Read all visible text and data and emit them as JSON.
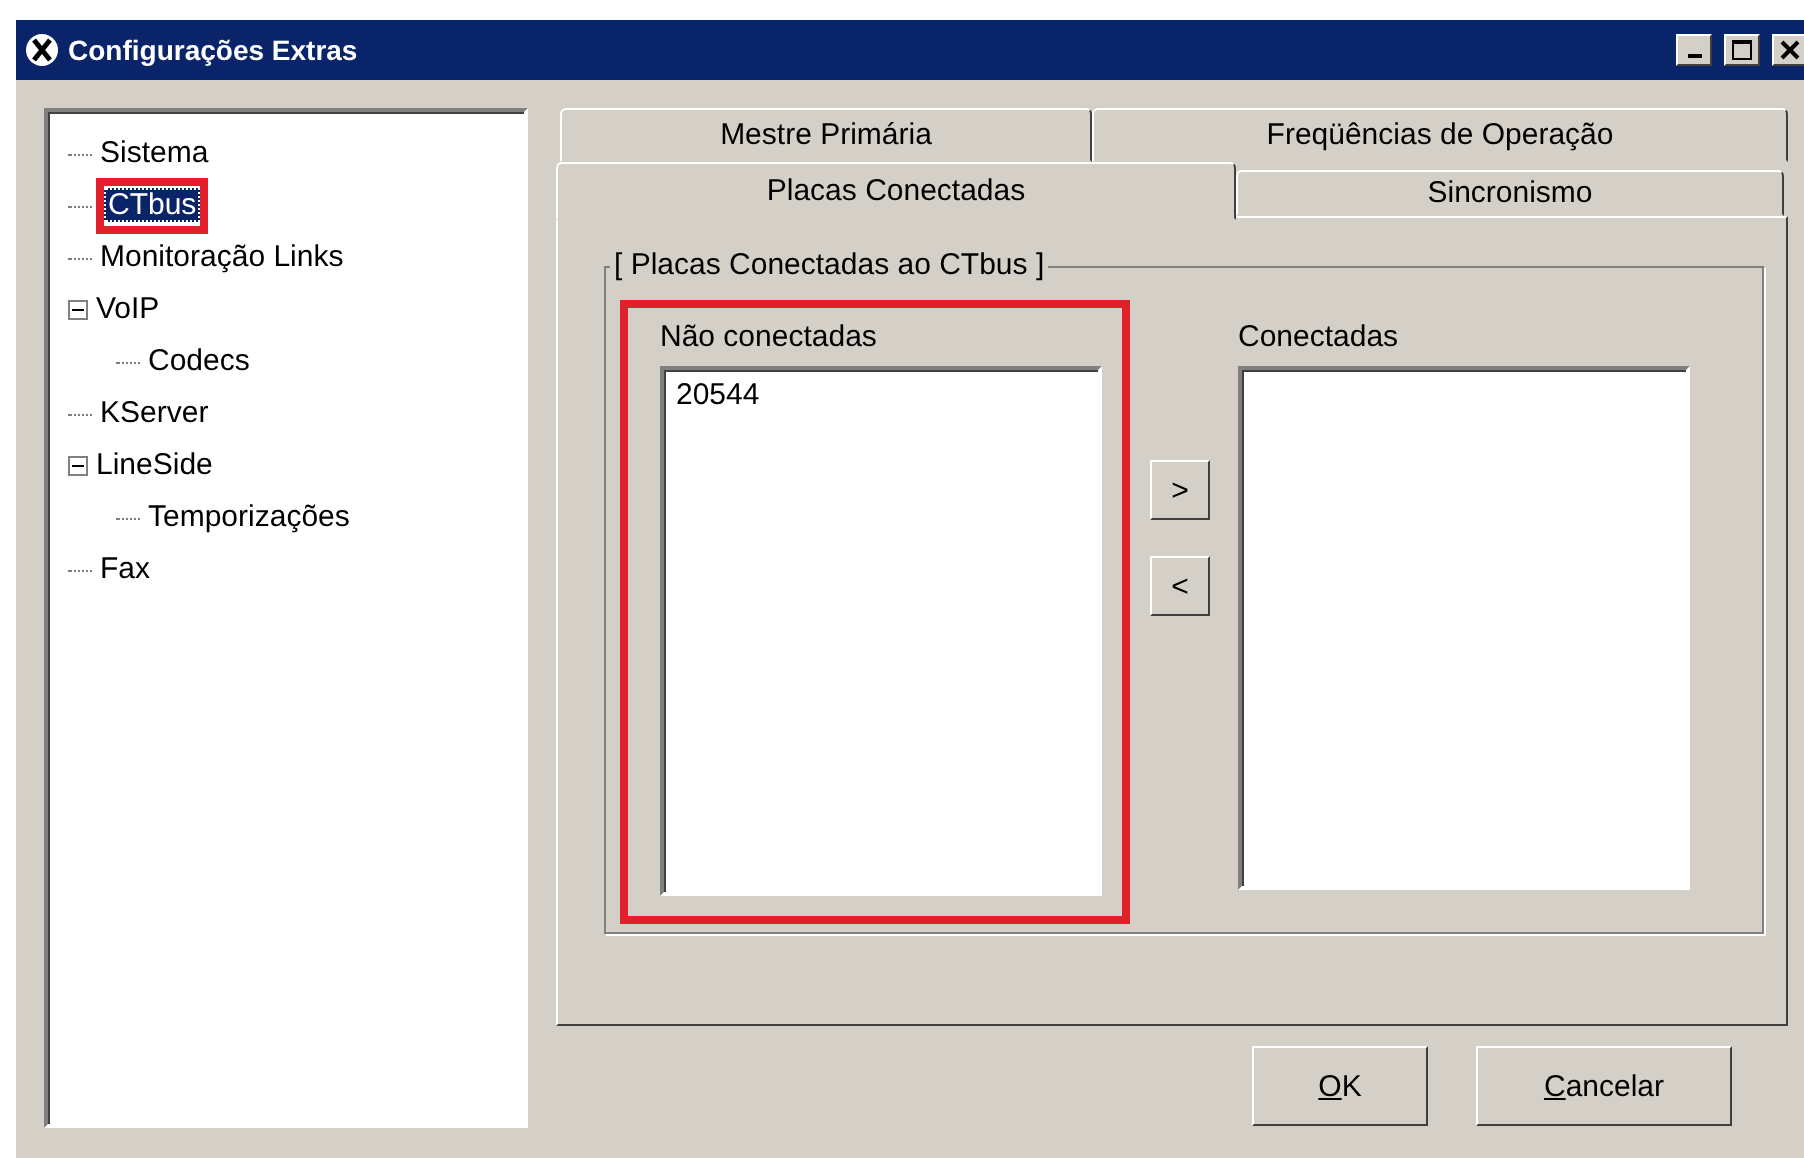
{
  "window": {
    "title": "Configurações Extras"
  },
  "tree": [
    {
      "label": "Sistema",
      "selected": false
    },
    {
      "label": "CTbus",
      "selected": true,
      "highlighted": true
    },
    {
      "label": "Monitoração Links",
      "selected": false
    },
    {
      "label": "VoIP",
      "selected": false,
      "expanded": true,
      "children": [
        {
          "label": "Codecs",
          "selected": false
        }
      ]
    },
    {
      "label": "KServer",
      "selected": false
    },
    {
      "label": "LineSide",
      "selected": false,
      "expanded": true,
      "children": [
        {
          "label": "Temporizações",
          "selected": false
        }
      ]
    },
    {
      "label": "Fax",
      "selected": false
    }
  ],
  "tab_rows": [
    [
      {
        "label": "Mestre Primária",
        "selected": false
      },
      {
        "label": "Freqüências de Operação",
        "selected": false
      }
    ],
    [
      {
        "label": "Placas Conectadas",
        "selected": true
      },
      {
        "label": "Sincronismo",
        "selected": false
      }
    ]
  ],
  "group": {
    "title": "[ Placas Conectadas ao CTbus ]",
    "available": {
      "label": "Não conectadas",
      "items": [
        "20544"
      ],
      "highlighted": true
    },
    "move_buttons": [
      ">",
      "<"
    ],
    "connected": {
      "label": "Conectadas"
    }
  },
  "buttons": [
    {
      "mnemonic": "O",
      "rest": "K"
    },
    {
      "mnemonic": "C",
      "rest": "ancelar"
    }
  ]
}
